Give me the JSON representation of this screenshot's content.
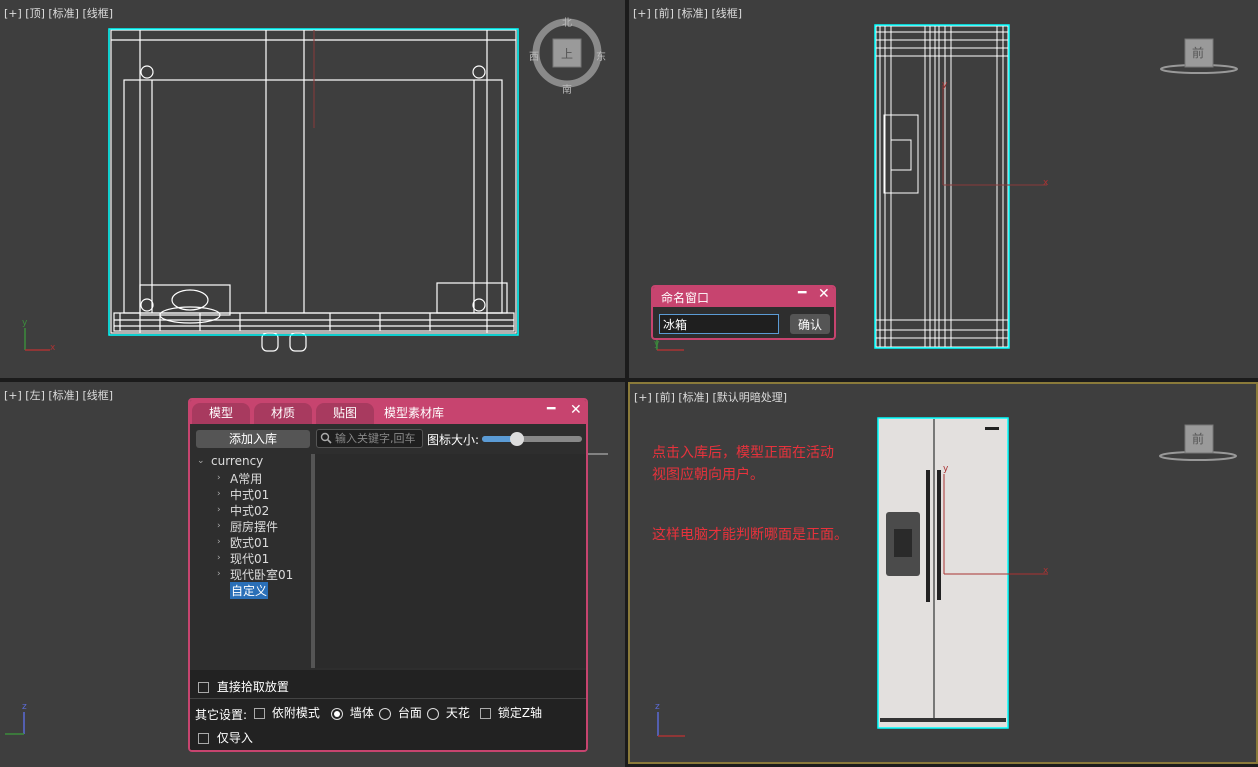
{
  "viewports": {
    "top": {
      "label": "[+] [顶] [标准] [线框]",
      "compass": {
        "north": "北",
        "south": "南",
        "east": "东",
        "west": "西",
        "cube": "上"
      }
    },
    "front": {
      "label": "[+] [前] [标准] [线框]",
      "cube": "前"
    },
    "left": {
      "label": "[+] [左] [标准] [线框]"
    },
    "perspective": {
      "label": "[+] [前] [标准] [默认明暗处理]",
      "cube": "前"
    }
  },
  "axes": {
    "x": "x",
    "y": "y",
    "z": "z"
  },
  "colors": {
    "accent": "#c7446f",
    "selection": "#00ffff",
    "note": "#e8323c",
    "active_border": "#8a7a3a"
  },
  "name_dialog": {
    "title": "命名窗口",
    "input_value": "冰箱",
    "confirm_label": "确认"
  },
  "library_dialog": {
    "tabs": [
      "模型",
      "材质",
      "贴图"
    ],
    "title": "模型素材库",
    "add_button": "添加入库",
    "search_placeholder": "输入关键字,回车",
    "icon_size_label": "图标大小:",
    "icon_size_level": 0.35,
    "tree": {
      "root": "currency",
      "children": [
        "A常用",
        "中式01",
        "中式02",
        "厨房摆件",
        "欧式01",
        "现代01",
        "现代卧室01"
      ],
      "selected": "自定义"
    },
    "direct_pick_label": "直接拾取放置",
    "other_settings_label": "其它设置:",
    "attach_mode_label": "依附模式",
    "radio_options": [
      "墙体",
      "台面",
      "天花"
    ],
    "radio_selected": "墙体",
    "lock_z_label": "锁定Z轴",
    "import_only_label": "仅导入"
  },
  "note": {
    "line1": "点击入库后，模型正面在活动",
    "line2": "视图应朝向用户。",
    "line3": "这样电脑才能判断哪面是正面。"
  }
}
